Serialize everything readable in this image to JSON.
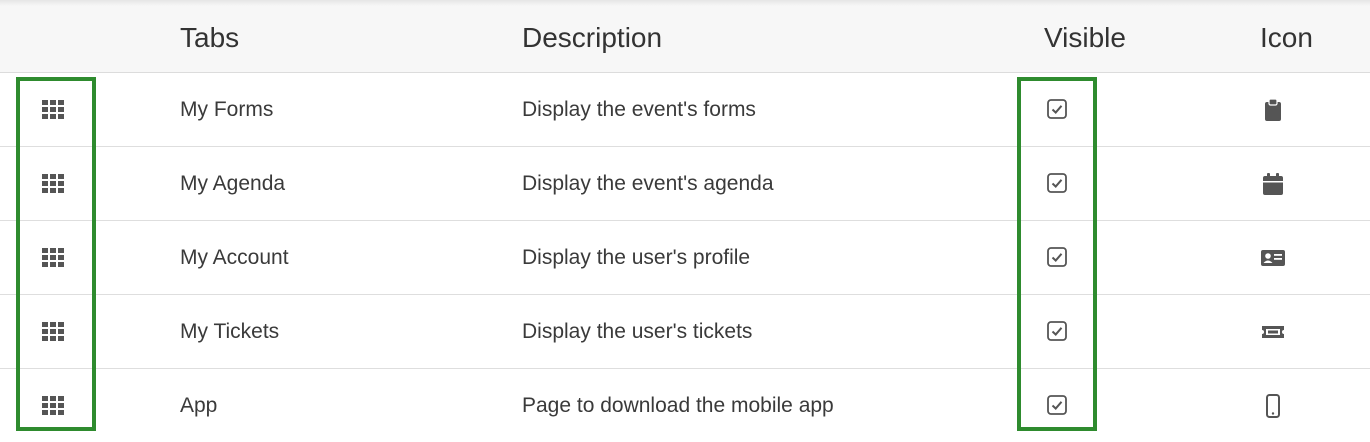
{
  "header": {
    "tabs_label": "Tabs",
    "description_label": "Description",
    "visible_label": "Visible",
    "icon_label": "Icon"
  },
  "rows": [
    {
      "tab": "My Forms",
      "description": "Display the event's forms",
      "visible": true,
      "icon": "clipboard-icon"
    },
    {
      "tab": "My Agenda",
      "description": "Display the event's agenda",
      "visible": true,
      "icon": "calendar-icon"
    },
    {
      "tab": "My Account",
      "description": "Display the user's profile",
      "visible": true,
      "icon": "id-card-icon"
    },
    {
      "tab": "My Tickets",
      "description": "Display the user's tickets",
      "visible": true,
      "icon": "ticket-icon"
    },
    {
      "tab": "App",
      "description": "Page to download the mobile app",
      "visible": true,
      "icon": "mobile-phone-icon"
    }
  ],
  "colors": {
    "highlight": "#2e8b2e",
    "icon": "#555555",
    "header_bg": "#f7f7f7"
  }
}
